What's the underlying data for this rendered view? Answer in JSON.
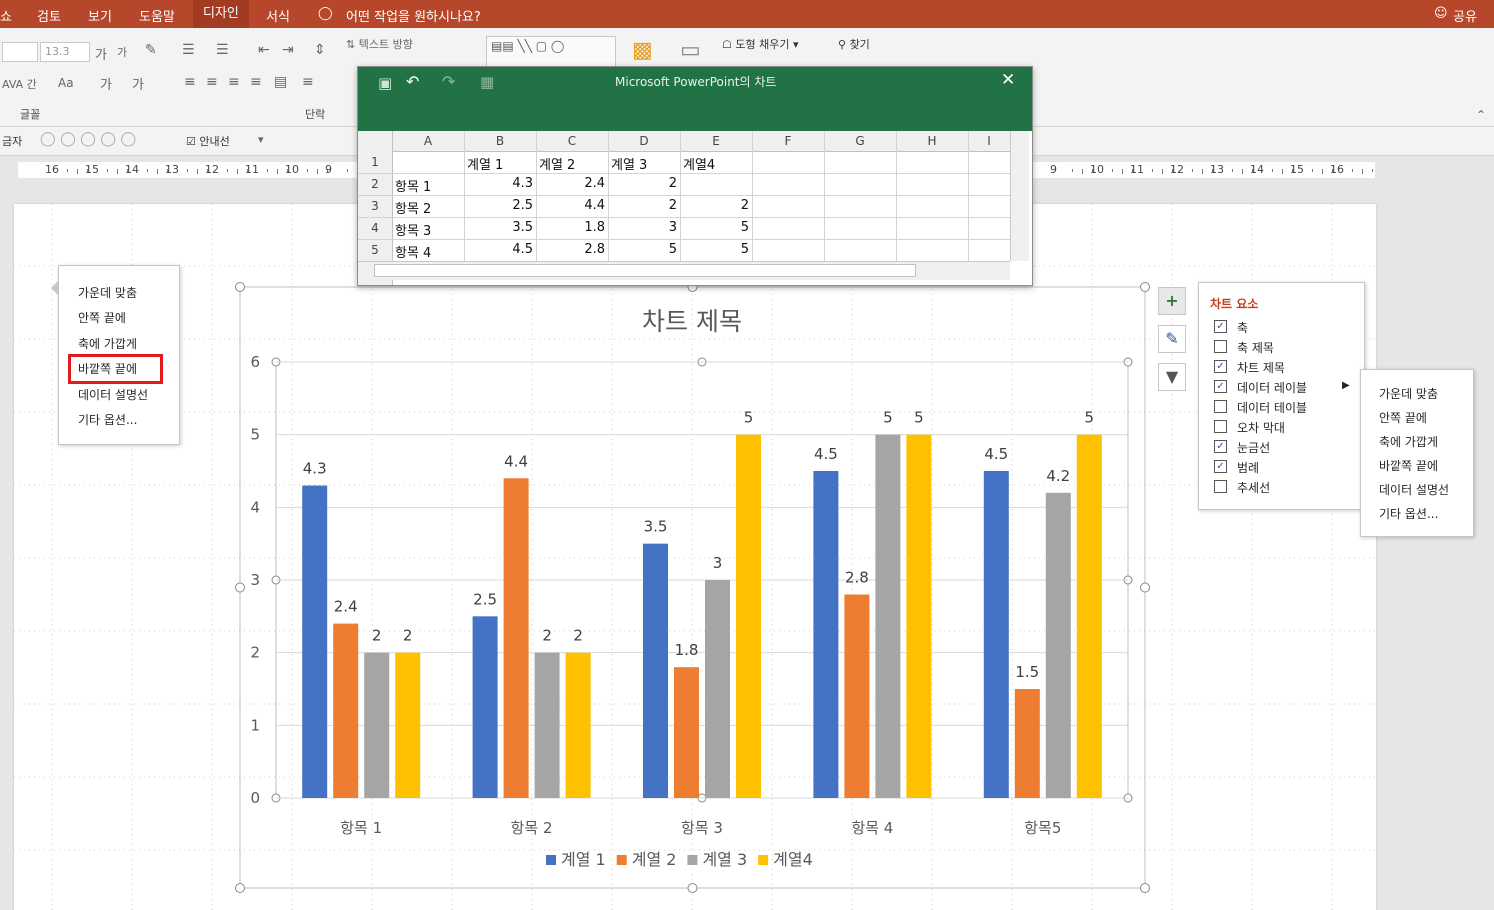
{
  "topbar": {
    "tabs": [
      "쇼",
      "검토",
      "보기",
      "도움말",
      "디자인",
      "서식"
    ],
    "tellme": "어떤 작업을 원하시나요?",
    "share": "공유"
  },
  "ribbon": {
    "font_size": "13.3",
    "text_direction": "텍스트 방향",
    "shape_fill": "도형 채우기",
    "find": "찾기",
    "group_font": "글꼴",
    "group_paragraph": "단락"
  },
  "subbar": {
    "label_left": "금자",
    "guides": "안내선"
  },
  "ruler": {
    "left": [
      "16",
      "15",
      "14",
      "13",
      "12",
      "11",
      "10",
      "9"
    ],
    "right": [
      "9",
      "10",
      "11",
      "12",
      "13",
      "14",
      "15",
      "16"
    ]
  },
  "excel": {
    "title": "Microsoft PowerPoint의 차트",
    "col_headers": [
      "A",
      "B",
      "C",
      "D",
      "E",
      "F",
      "G",
      "H",
      "I"
    ],
    "row_headers": [
      "1",
      "2",
      "3",
      "4",
      "5"
    ],
    "rows": [
      [
        "",
        "계열 1",
        "계열 2",
        "계열 3",
        "계열4"
      ],
      [
        "항목 1",
        "4.3",
        "2.4",
        "2",
        ""
      ],
      [
        "항목 2",
        "2.5",
        "4.4",
        "2",
        "2"
      ],
      [
        "항목 3",
        "3.5",
        "1.8",
        "3",
        "5"
      ],
      [
        "항목 4",
        "4.5",
        "2.8",
        "5",
        "5"
      ]
    ]
  },
  "left_menu": {
    "items": [
      "가운데 맞춤",
      "안쪽 끝에",
      "축에 가깝게",
      "바깥쪽 끝에",
      "데이터 설명선",
      "기타 옵션..."
    ],
    "highlight_index": 3
  },
  "chart_elements": {
    "title": "차트 요소",
    "items": [
      {
        "label": "축",
        "checked": true
      },
      {
        "label": "축 제목",
        "checked": false
      },
      {
        "label": "차트 제목",
        "checked": true
      },
      {
        "label": "데이터 레이블",
        "checked": true
      },
      {
        "label": "데이터 테이블",
        "checked": false
      },
      {
        "label": "오차 막대",
        "checked": false
      },
      {
        "label": "눈금선",
        "checked": true
      },
      {
        "label": "범례",
        "checked": true
      },
      {
        "label": "추세선",
        "checked": false
      }
    ],
    "accent": "#c43e1c"
  },
  "submenu": {
    "items": [
      "가운데 맞춤",
      "안쪽 끝에",
      "축에 가깝게",
      "바깥쪽 끝에",
      "데이터 설명선",
      "기타 옵션..."
    ]
  },
  "chart_data": {
    "type": "bar",
    "title": "차트 제목",
    "categories": [
      "항목 1",
      "항목 2",
      "항목 3",
      "항목 4",
      "항목5"
    ],
    "series": [
      {
        "name": "계열 1",
        "color": "#4472c4",
        "values": [
          4.3,
          2.5,
          3.5,
          4.5,
          4.5
        ]
      },
      {
        "name": "계열 2",
        "color": "#ed7d31",
        "values": [
          2.4,
          4.4,
          1.8,
          2.8,
          1.5
        ]
      },
      {
        "name": "계열 3",
        "color": "#a5a5a5",
        "values": [
          2,
          2,
          3,
          5,
          4.2
        ]
      },
      {
        "name": "계열4",
        "color": "#ffc000",
        "values": [
          2,
          2,
          5,
          5,
          5
        ]
      }
    ],
    "ylim": [
      0,
      6
    ],
    "yticks": [
      0,
      1,
      2,
      3,
      4,
      5,
      6
    ],
    "grid": true,
    "legend": "bottom",
    "data_labels": "outside-end"
  }
}
